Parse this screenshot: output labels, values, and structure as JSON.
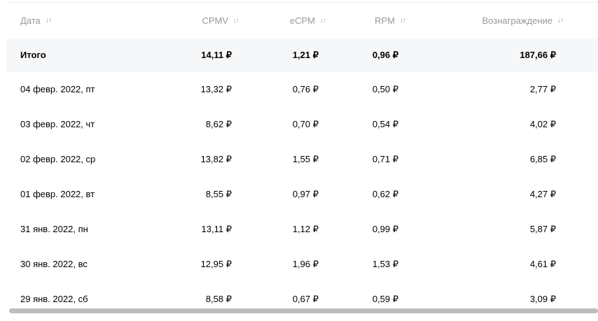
{
  "table": {
    "columns": [
      {
        "label": "Дата",
        "sort_icon": "↓↑"
      },
      {
        "label": "CPMV",
        "sort_icon": "↓↑"
      },
      {
        "label": "eCPM",
        "sort_icon": "↓↑"
      },
      {
        "label": "RPM",
        "sort_icon": "↓↑"
      },
      {
        "label": "Вознаграждение",
        "sort_icon": "↓↑"
      }
    ],
    "total": {
      "label": "Итого",
      "cpmv": "14,11 ₽",
      "ecpm": "1,21 ₽",
      "rpm": "0,96 ₽",
      "reward": "187,66 ₽"
    },
    "rows": [
      {
        "date": "04 февр. 2022, пт",
        "cpmv": "13,32 ₽",
        "ecpm": "0,76 ₽",
        "rpm": "0,50 ₽",
        "reward": "2,77 ₽"
      },
      {
        "date": "03 февр. 2022, чт",
        "cpmv": "8,62 ₽",
        "ecpm": "0,70 ₽",
        "rpm": "0,54 ₽",
        "reward": "4,02 ₽"
      },
      {
        "date": "02 февр. 2022, ср",
        "cpmv": "13,82 ₽",
        "ecpm": "1,55 ₽",
        "rpm": "0,71 ₽",
        "reward": "6,85 ₽"
      },
      {
        "date": "01 февр. 2022, вт",
        "cpmv": "8,55 ₽",
        "ecpm": "0,97 ₽",
        "rpm": "0,62 ₽",
        "reward": "4,27 ₽"
      },
      {
        "date": "31 янв. 2022, пн",
        "cpmv": "13,11 ₽",
        "ecpm": "1,12 ₽",
        "rpm": "0,99 ₽",
        "reward": "5,87 ₽"
      },
      {
        "date": "30 янв. 2022, вс",
        "cpmv": "12,95 ₽",
        "ecpm": "1,96 ₽",
        "rpm": "1,53 ₽",
        "reward": "4,61 ₽"
      },
      {
        "date": "29 янв. 2022, сб",
        "cpmv": "8,58 ₽",
        "ecpm": "0,67 ₽",
        "rpm": "0,59 ₽",
        "reward": "3,09 ₽"
      }
    ]
  },
  "colors": {
    "header_text": "#999999",
    "total_row_bg": "#f6f7f8",
    "scrollbar": "#bdbdbd"
  }
}
